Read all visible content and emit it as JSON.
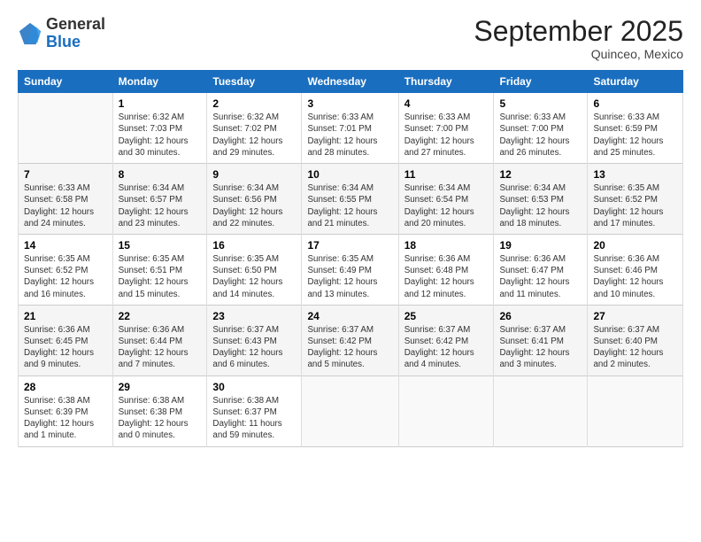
{
  "header": {
    "logo_line1": "General",
    "logo_line2": "Blue",
    "month_title": "September 2025",
    "subtitle": "Quinceo, Mexico"
  },
  "days_of_week": [
    "Sunday",
    "Monday",
    "Tuesday",
    "Wednesday",
    "Thursday",
    "Friday",
    "Saturday"
  ],
  "weeks": [
    [
      {
        "day": "",
        "info": ""
      },
      {
        "day": "1",
        "info": "Sunrise: 6:32 AM\nSunset: 7:03 PM\nDaylight: 12 hours\nand 30 minutes."
      },
      {
        "day": "2",
        "info": "Sunrise: 6:32 AM\nSunset: 7:02 PM\nDaylight: 12 hours\nand 29 minutes."
      },
      {
        "day": "3",
        "info": "Sunrise: 6:33 AM\nSunset: 7:01 PM\nDaylight: 12 hours\nand 28 minutes."
      },
      {
        "day": "4",
        "info": "Sunrise: 6:33 AM\nSunset: 7:00 PM\nDaylight: 12 hours\nand 27 minutes."
      },
      {
        "day": "5",
        "info": "Sunrise: 6:33 AM\nSunset: 7:00 PM\nDaylight: 12 hours\nand 26 minutes."
      },
      {
        "day": "6",
        "info": "Sunrise: 6:33 AM\nSunset: 6:59 PM\nDaylight: 12 hours\nand 25 minutes."
      }
    ],
    [
      {
        "day": "7",
        "info": "Sunrise: 6:33 AM\nSunset: 6:58 PM\nDaylight: 12 hours\nand 24 minutes."
      },
      {
        "day": "8",
        "info": "Sunrise: 6:34 AM\nSunset: 6:57 PM\nDaylight: 12 hours\nand 23 minutes."
      },
      {
        "day": "9",
        "info": "Sunrise: 6:34 AM\nSunset: 6:56 PM\nDaylight: 12 hours\nand 22 minutes."
      },
      {
        "day": "10",
        "info": "Sunrise: 6:34 AM\nSunset: 6:55 PM\nDaylight: 12 hours\nand 21 minutes."
      },
      {
        "day": "11",
        "info": "Sunrise: 6:34 AM\nSunset: 6:54 PM\nDaylight: 12 hours\nand 20 minutes."
      },
      {
        "day": "12",
        "info": "Sunrise: 6:34 AM\nSunset: 6:53 PM\nDaylight: 12 hours\nand 18 minutes."
      },
      {
        "day": "13",
        "info": "Sunrise: 6:35 AM\nSunset: 6:52 PM\nDaylight: 12 hours\nand 17 minutes."
      }
    ],
    [
      {
        "day": "14",
        "info": "Sunrise: 6:35 AM\nSunset: 6:52 PM\nDaylight: 12 hours\nand 16 minutes."
      },
      {
        "day": "15",
        "info": "Sunrise: 6:35 AM\nSunset: 6:51 PM\nDaylight: 12 hours\nand 15 minutes."
      },
      {
        "day": "16",
        "info": "Sunrise: 6:35 AM\nSunset: 6:50 PM\nDaylight: 12 hours\nand 14 minutes."
      },
      {
        "day": "17",
        "info": "Sunrise: 6:35 AM\nSunset: 6:49 PM\nDaylight: 12 hours\nand 13 minutes."
      },
      {
        "day": "18",
        "info": "Sunrise: 6:36 AM\nSunset: 6:48 PM\nDaylight: 12 hours\nand 12 minutes."
      },
      {
        "day": "19",
        "info": "Sunrise: 6:36 AM\nSunset: 6:47 PM\nDaylight: 12 hours\nand 11 minutes."
      },
      {
        "day": "20",
        "info": "Sunrise: 6:36 AM\nSunset: 6:46 PM\nDaylight: 12 hours\nand 10 minutes."
      }
    ],
    [
      {
        "day": "21",
        "info": "Sunrise: 6:36 AM\nSunset: 6:45 PM\nDaylight: 12 hours\nand 9 minutes."
      },
      {
        "day": "22",
        "info": "Sunrise: 6:36 AM\nSunset: 6:44 PM\nDaylight: 12 hours\nand 7 minutes."
      },
      {
        "day": "23",
        "info": "Sunrise: 6:37 AM\nSunset: 6:43 PM\nDaylight: 12 hours\nand 6 minutes."
      },
      {
        "day": "24",
        "info": "Sunrise: 6:37 AM\nSunset: 6:42 PM\nDaylight: 12 hours\nand 5 minutes."
      },
      {
        "day": "25",
        "info": "Sunrise: 6:37 AM\nSunset: 6:42 PM\nDaylight: 12 hours\nand 4 minutes."
      },
      {
        "day": "26",
        "info": "Sunrise: 6:37 AM\nSunset: 6:41 PM\nDaylight: 12 hours\nand 3 minutes."
      },
      {
        "day": "27",
        "info": "Sunrise: 6:37 AM\nSunset: 6:40 PM\nDaylight: 12 hours\nand 2 minutes."
      }
    ],
    [
      {
        "day": "28",
        "info": "Sunrise: 6:38 AM\nSunset: 6:39 PM\nDaylight: 12 hours\nand 1 minute."
      },
      {
        "day": "29",
        "info": "Sunrise: 6:38 AM\nSunset: 6:38 PM\nDaylight: 12 hours\nand 0 minutes."
      },
      {
        "day": "30",
        "info": "Sunrise: 6:38 AM\nSunset: 6:37 PM\nDaylight: 11 hours\nand 59 minutes."
      },
      {
        "day": "",
        "info": ""
      },
      {
        "day": "",
        "info": ""
      },
      {
        "day": "",
        "info": ""
      },
      {
        "day": "",
        "info": ""
      }
    ]
  ]
}
